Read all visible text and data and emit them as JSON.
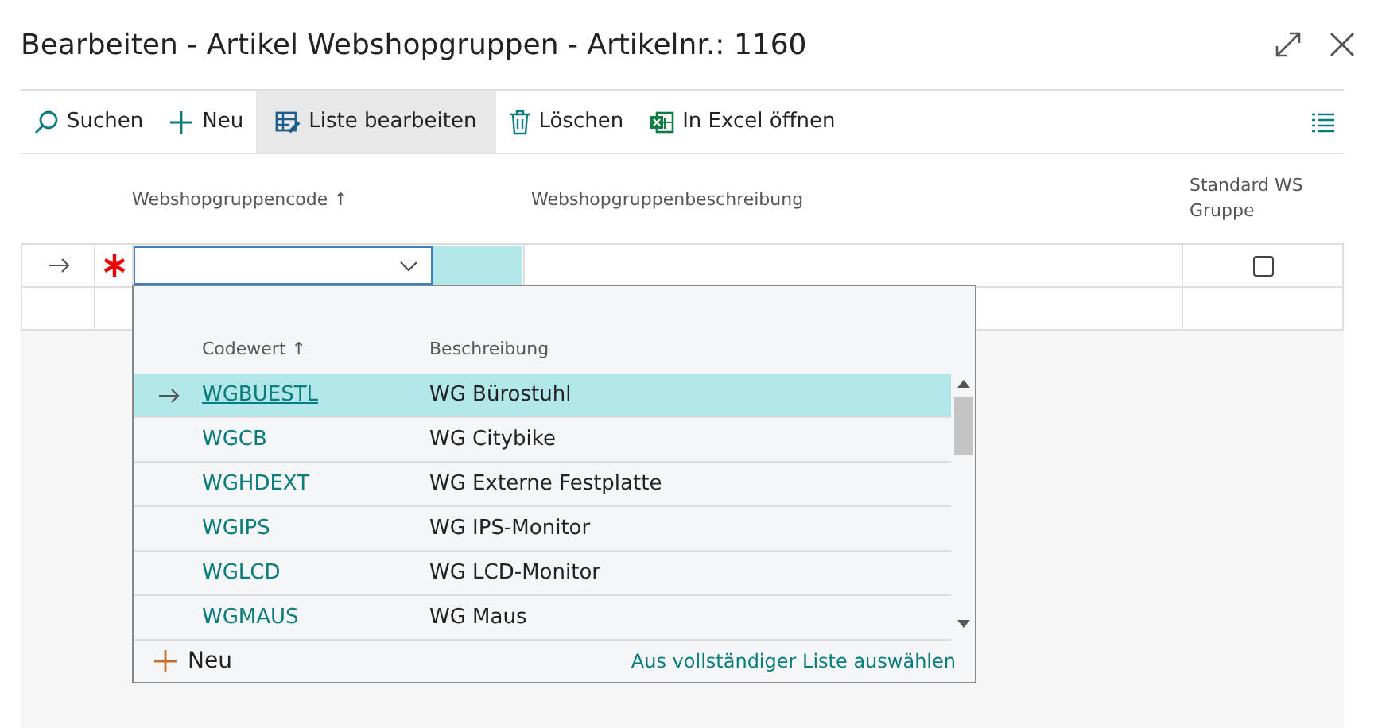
{
  "window": {
    "title": "Bearbeiten - Artikel Webshopgruppen - Artikelnr.: 1160"
  },
  "toolbar": [
    {
      "kind": "search",
      "label": "Suchen",
      "selected": false
    },
    {
      "kind": "new",
      "label": "Neu",
      "selected": false
    },
    {
      "kind": "editlist",
      "label": "Liste bearbeiten",
      "selected": true
    },
    {
      "kind": "delete",
      "label": "Löschen",
      "selected": false
    },
    {
      "kind": "excel",
      "label": "In Excel öffnen",
      "selected": false
    }
  ],
  "table": {
    "columns": [
      "Webshopgruppencode ↑",
      "Webshopgruppenbeschreibung",
      "Standard WS Gruppe"
    ],
    "rows": [
      {
        "current": true,
        "required": true,
        "code": "",
        "description": "",
        "standard": false
      }
    ]
  },
  "lookup": {
    "columns": [
      "Codewert ↑",
      "Beschreibung"
    ],
    "rows": [
      {
        "code": "WGBUESTL",
        "description": "WG Bürostuhl",
        "selected": true
      },
      {
        "code": "WGCB",
        "description": "WG Citybike",
        "selected": false
      },
      {
        "code": "WGHDEXT",
        "description": "WG Externe Festplatte",
        "selected": false
      },
      {
        "code": "WGIPS",
        "description": "WG IPS-Monitor",
        "selected": false
      },
      {
        "code": "WGLCD",
        "description": "WG LCD-Monitor",
        "selected": false
      },
      {
        "code": "WGMAUS",
        "description": "WG Maus",
        "selected": false
      }
    ],
    "new_label": "Neu",
    "full_list_link": "Aus vollständiger Liste auswählen"
  }
}
